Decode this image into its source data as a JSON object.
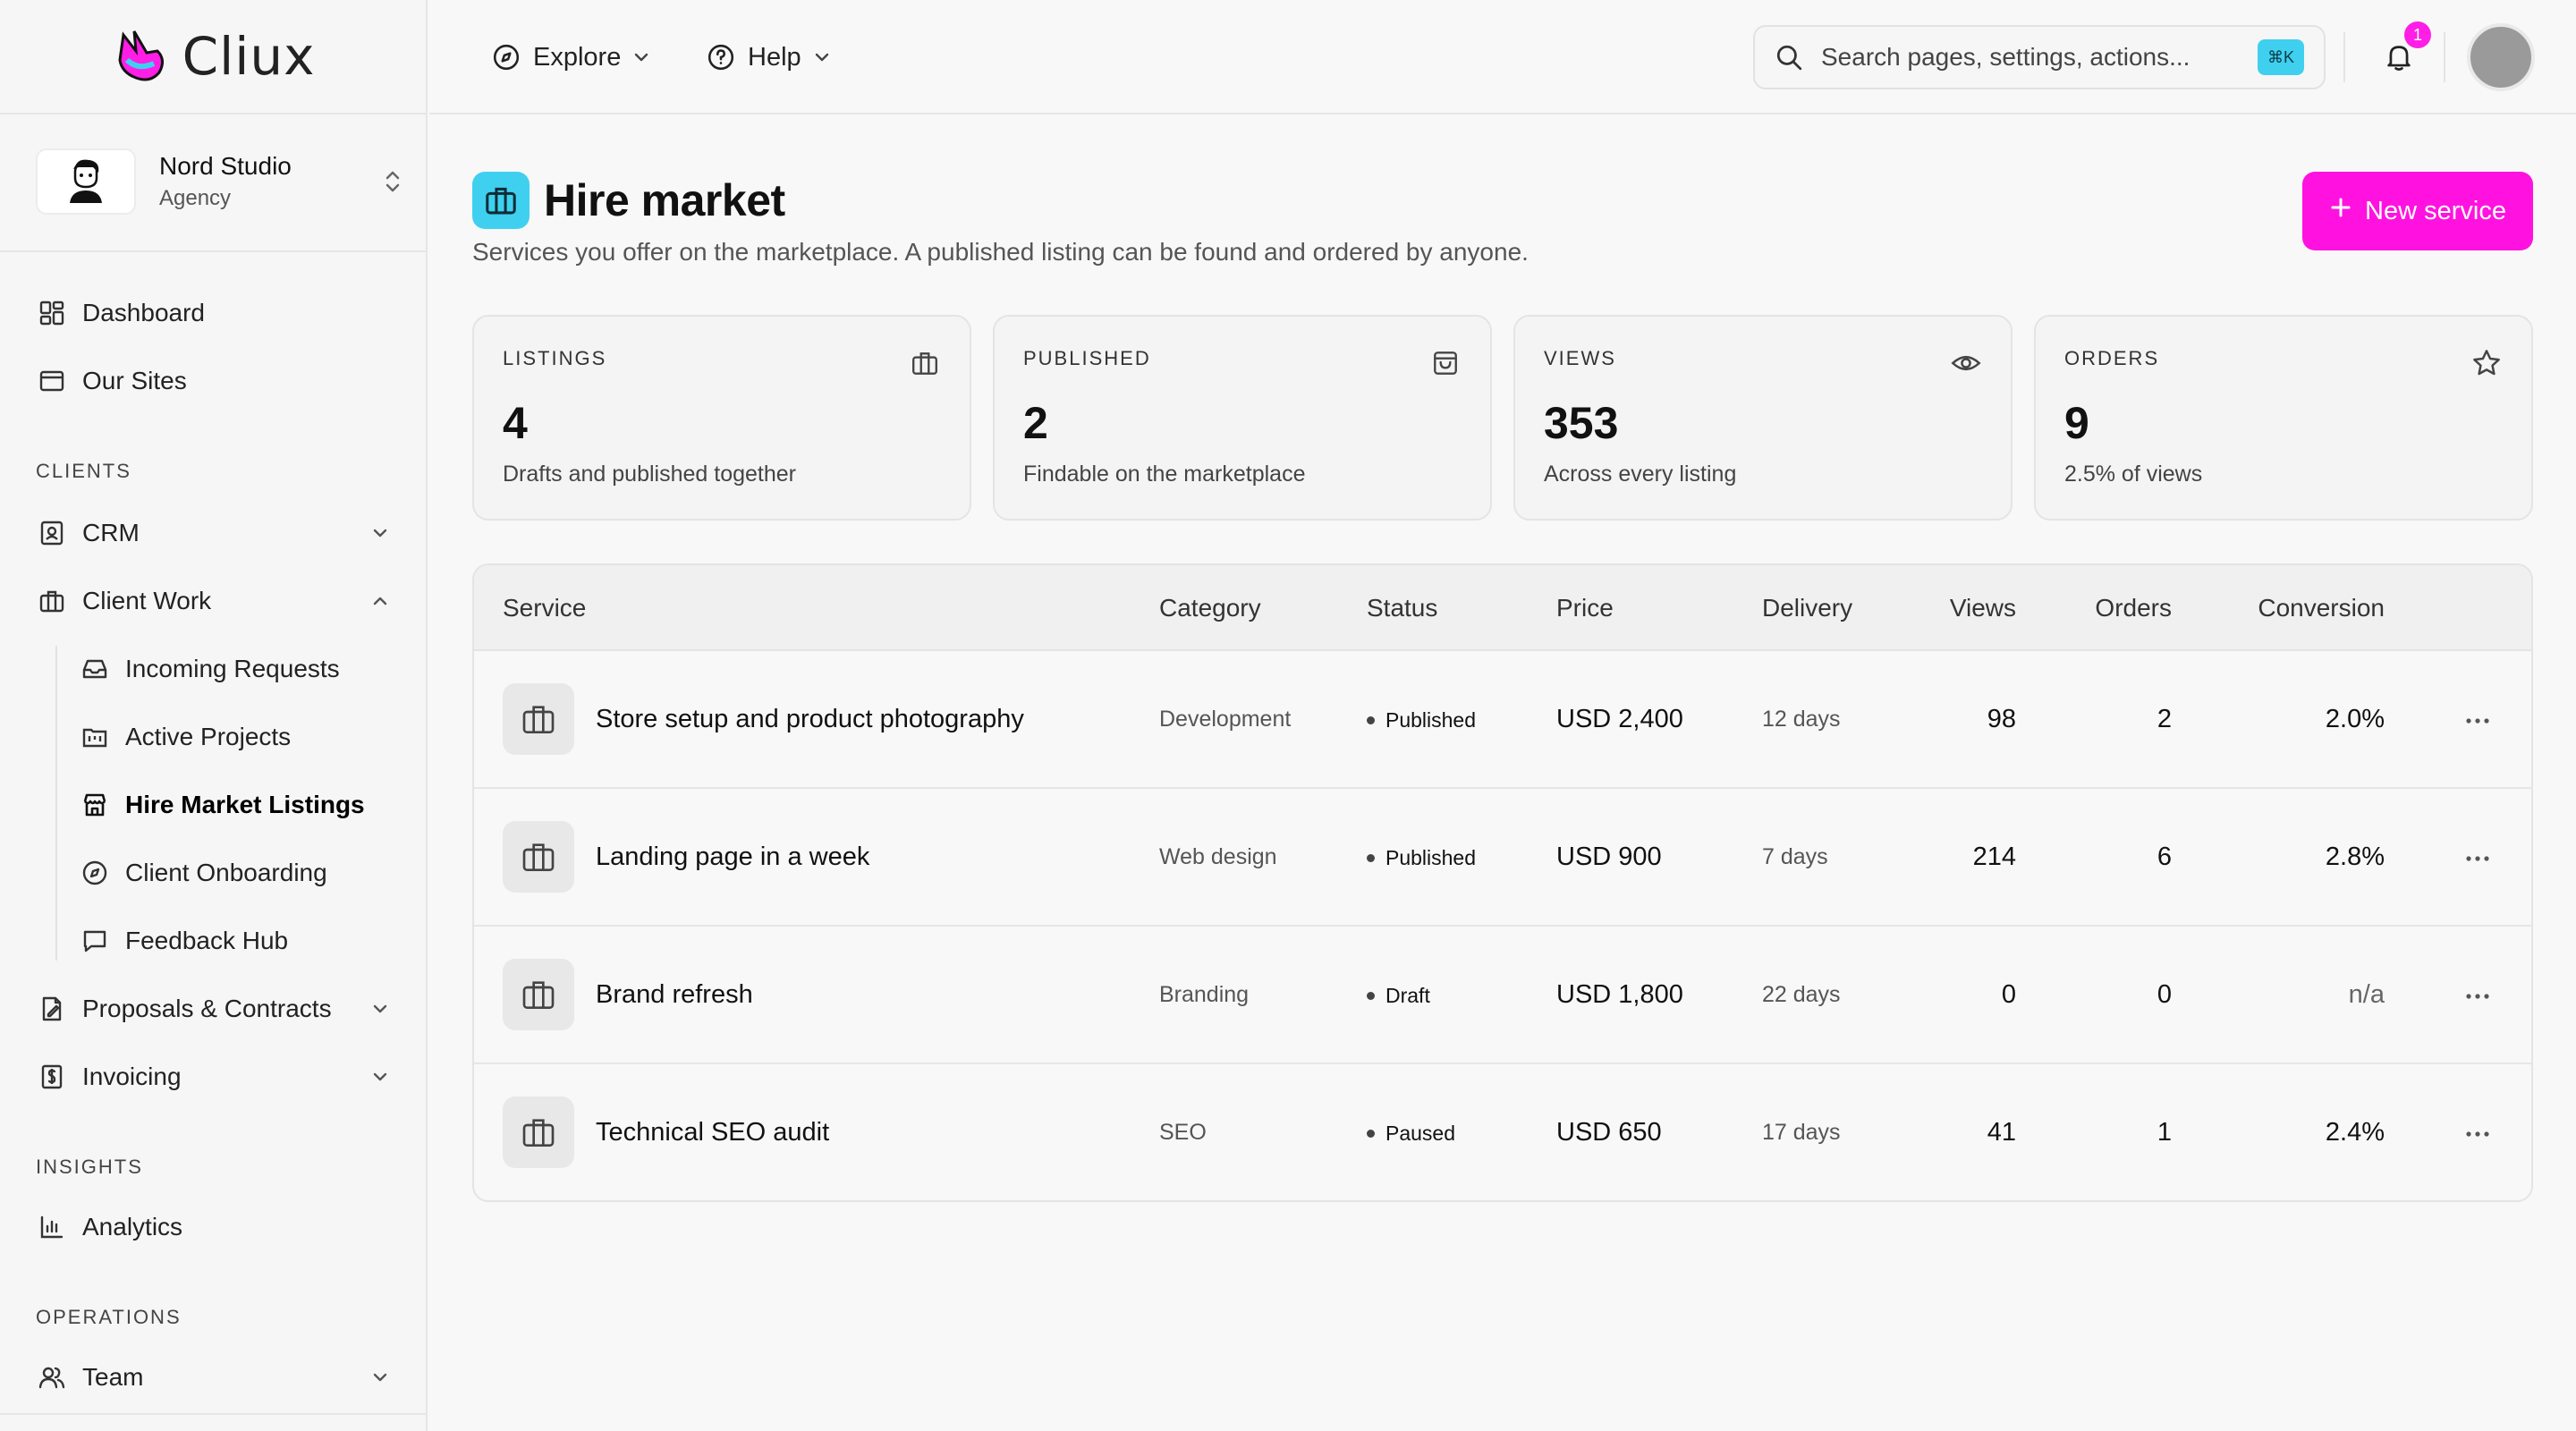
{
  "brand": {
    "name": "Cliux"
  },
  "workspace": {
    "name": "Nord Studio",
    "type": "Agency"
  },
  "sidebar": {
    "top": [
      {
        "label": "Dashboard"
      },
      {
        "label": "Our Sites"
      }
    ],
    "sections": {
      "clients": "CLIENTS",
      "insights": "INSIGHTS",
      "operations": "OPERATIONS"
    },
    "clients": {
      "crm": "CRM",
      "client_work": "Client Work",
      "sub": [
        "Incoming Requests",
        "Active Projects",
        "Hire Market Listings",
        "Client Onboarding",
        "Feedback Hub"
      ],
      "proposals": "Proposals & Contracts",
      "invoicing": "Invoicing"
    },
    "insights": {
      "analytics": "Analytics"
    },
    "operations": {
      "team": "Team"
    }
  },
  "topbar": {
    "explore": "Explore",
    "help": "Help",
    "search_placeholder": "Search pages, settings, actions...",
    "shortcut": "⌘K",
    "notifications_count": "1"
  },
  "page": {
    "title": "Hire market",
    "subtitle": "Services you offer on the marketplace. A published listing can be found and ordered by anyone.",
    "new_button": "New service"
  },
  "stats": [
    {
      "label": "LISTINGS",
      "value": "4",
      "caption": "Drafts and published together"
    },
    {
      "label": "PUBLISHED",
      "value": "2",
      "caption": "Findable on the marketplace"
    },
    {
      "label": "VIEWS",
      "value": "353",
      "caption": "Across every listing"
    },
    {
      "label": "ORDERS",
      "value": "9",
      "caption": "2.5% of views"
    }
  ],
  "table": {
    "headers": [
      "Service",
      "Category",
      "Status",
      "Price",
      "Delivery",
      "Views",
      "Orders",
      "Conversion"
    ],
    "rows": [
      {
        "service": "Store setup and product photography",
        "category": "Development",
        "status": "Published",
        "price": "USD 2,400",
        "delivery": "12 days",
        "views": "98",
        "orders": "2",
        "conversion": "2.0%"
      },
      {
        "service": "Landing page in a week",
        "category": "Web design",
        "status": "Published",
        "price": "USD 900",
        "delivery": "7 days",
        "views": "214",
        "orders": "6",
        "conversion": "2.8%"
      },
      {
        "service": "Brand refresh",
        "category": "Branding",
        "status": "Draft",
        "price": "USD 1,800",
        "delivery": "22 days",
        "views": "0",
        "orders": "0",
        "conversion": "n/a"
      },
      {
        "service": "Technical SEO audit",
        "category": "SEO",
        "status": "Paused",
        "price": "USD 650",
        "delivery": "17 days",
        "views": "41",
        "orders": "1",
        "conversion": "2.4%"
      }
    ]
  },
  "colors": {
    "accent": "#ff12e0",
    "cyan": "#3fd0ef",
    "badge": "#ff1ee6"
  }
}
